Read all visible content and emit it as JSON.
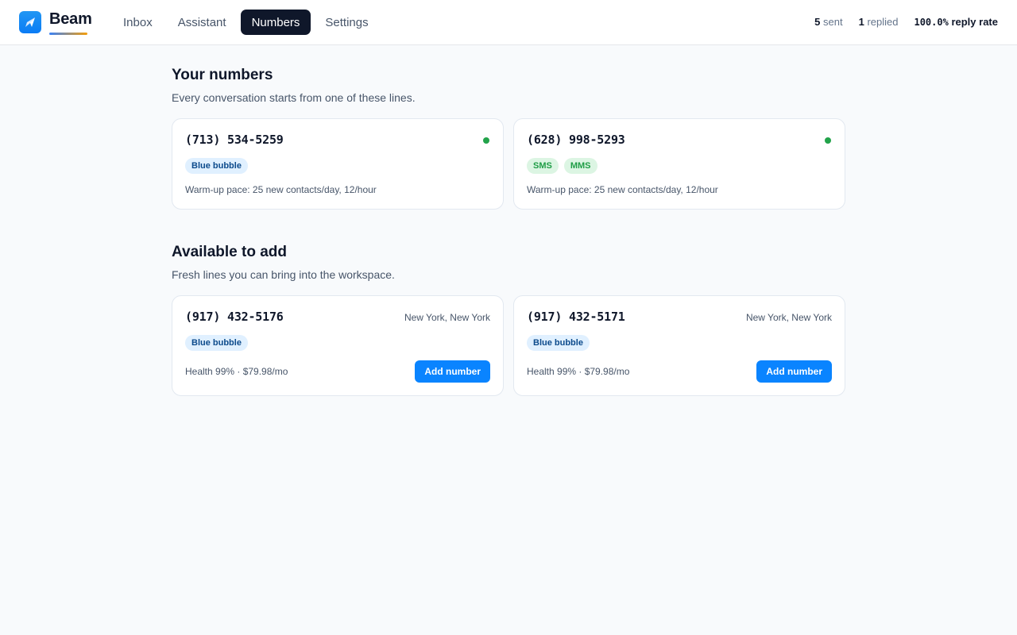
{
  "app": {
    "brand": "Beam",
    "icons": {
      "logo": "paper-plane-icon"
    },
    "colors": {
      "accent": "#0a84ff",
      "online": "#22a34a",
      "nav_active": "#0f172a"
    }
  },
  "nav": {
    "items": [
      {
        "label": "Inbox",
        "active": false
      },
      {
        "label": "Assistant",
        "active": false
      },
      {
        "label": "Numbers",
        "active": true
      },
      {
        "label": "Settings",
        "active": false
      }
    ]
  },
  "stats": {
    "sent_value": "5",
    "sent_label": "sent",
    "replied_value": "1",
    "replied_label": "replied",
    "rate_value": "100.0%",
    "rate_label": "reply rate"
  },
  "your_numbers": {
    "title": "Your numbers",
    "subtitle": "Every conversation starts from one of these lines.",
    "cards": [
      {
        "phone": "(713) 534-5259",
        "status": "active",
        "badges": [
          "Blue bubble"
        ],
        "pace": "Warm-up pace: 25 new contacts/day, 12/hour"
      },
      {
        "phone": "(628) 998-5293",
        "status": "active",
        "badges": [
          "SMS",
          "MMS"
        ],
        "pace": "Warm-up pace: 25 new contacts/day, 12/hour"
      }
    ]
  },
  "available": {
    "title": "Available to add",
    "subtitle": "Fresh lines you can bring into the workspace.",
    "cards": [
      {
        "phone": "(917) 432-5176",
        "location": "New York, New York",
        "badges": [
          "Blue bubble"
        ],
        "details": "Health 99% · $79.98/mo",
        "button": "Add number"
      },
      {
        "phone": "(917) 432-5171",
        "location": "New York, New York",
        "badges": [
          "Blue bubble"
        ],
        "details": "Health 99% · $79.98/mo",
        "button": "Add number"
      }
    ]
  }
}
